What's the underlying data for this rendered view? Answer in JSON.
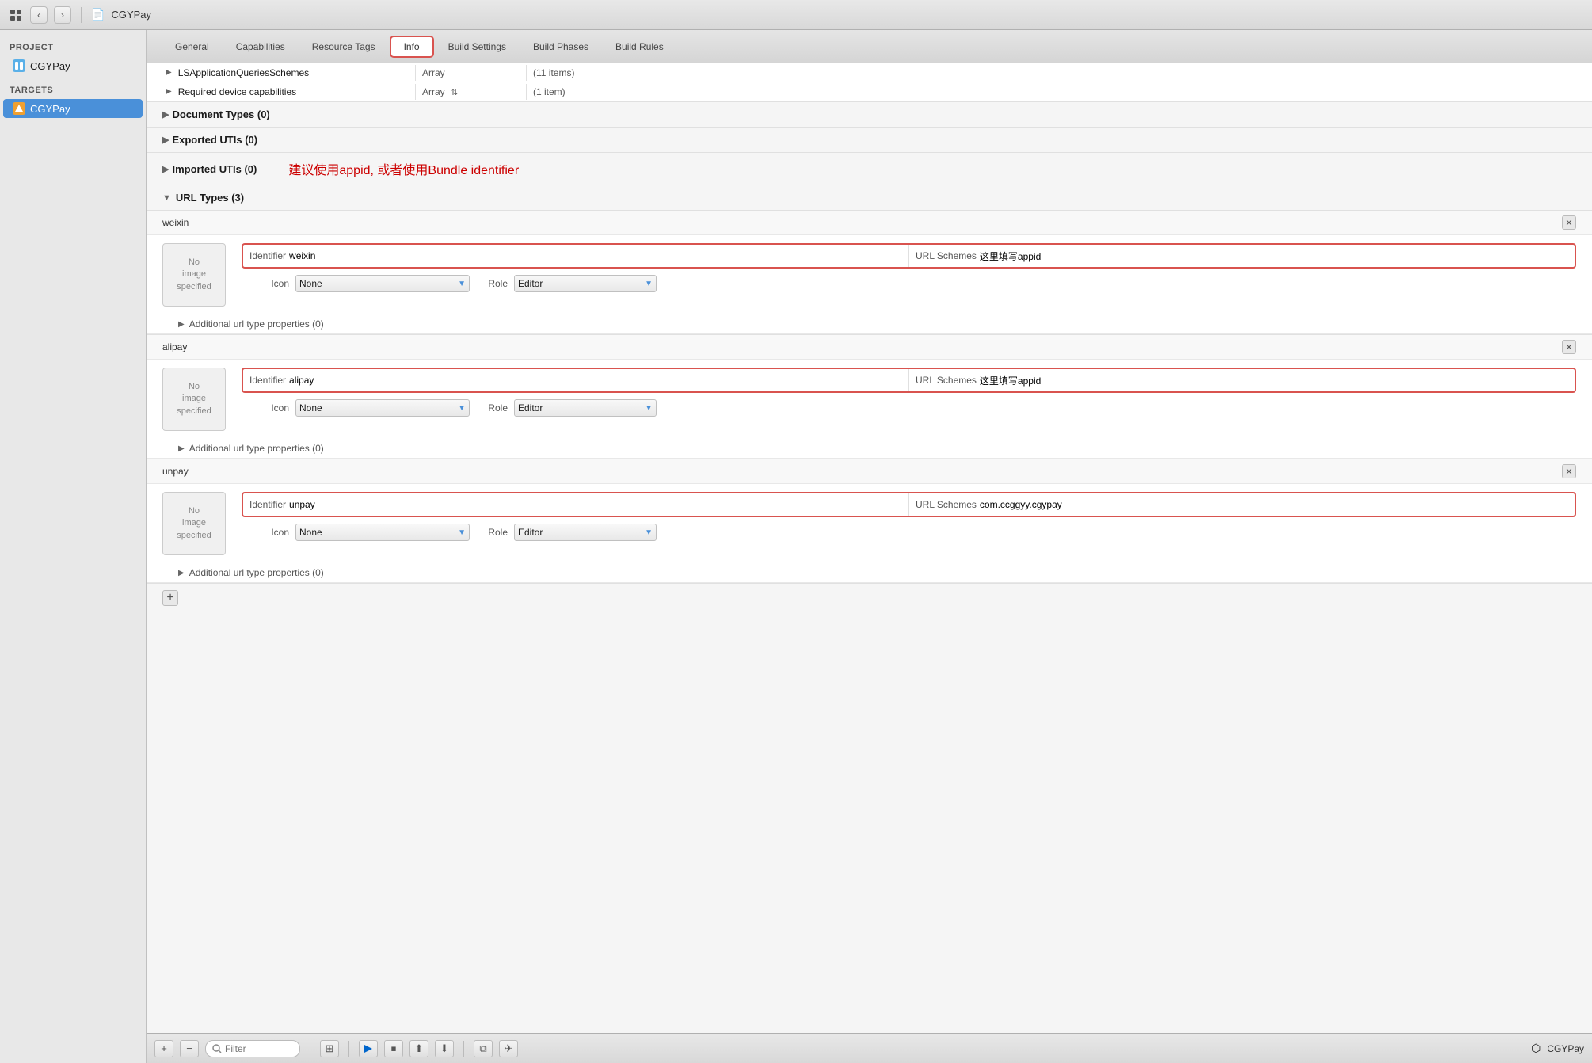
{
  "topToolbar": {
    "appName": "CGYPay",
    "navBack": "‹",
    "navForward": "›"
  },
  "sidebar": {
    "projectLabel": "PROJECT",
    "projectName": "CGYPay",
    "targetsLabel": "TARGETS",
    "targetName": "CGYPay"
  },
  "tabs": [
    {
      "label": "General",
      "active": false
    },
    {
      "label": "Capabilities",
      "active": false
    },
    {
      "label": "Resource Tags",
      "active": false
    },
    {
      "label": "Info",
      "active": true
    },
    {
      "label": "Build Settings",
      "active": false
    },
    {
      "label": "Build Phases",
      "active": false
    },
    {
      "label": "Build Rules",
      "active": false
    }
  ],
  "plistRows": [
    {
      "key": "LSApplicationQueriesSchemes",
      "type": "Array",
      "value": "(11 items)"
    },
    {
      "key": "Required device capabilities",
      "type": "Array",
      "value": "(1 item)"
    }
  ],
  "sections": [
    {
      "label": "Document Types (0)",
      "expanded": false
    },
    {
      "label": "Exported UTIs (0)",
      "expanded": false
    },
    {
      "label": "Imported UTIs (0)",
      "expanded": false
    }
  ],
  "advisoryText": "建议使用appid, 或者使用Bundle identifier",
  "urlTypesSection": {
    "label": "URL Types (3)",
    "expanded": true
  },
  "urlEntries": [
    {
      "name": "weixin",
      "identifier": "weixin",
      "urlSchemes": "这里填写appid",
      "icon": "None",
      "role": "Editor",
      "additionalLabel": "Additional url type properties (0)",
      "imageText": "No image specified"
    },
    {
      "name": "alipay",
      "identifier": "alipay",
      "urlSchemes": "这里填写appid",
      "icon": "None",
      "role": "Editor",
      "additionalLabel": "Additional url type properties (0)",
      "imageText": "No image specified"
    },
    {
      "name": "unpay",
      "identifier": "unpay",
      "urlSchemes": "com.ccggyy.cgypay",
      "icon": "None",
      "role": "Editor",
      "additionalLabel": "Additional url type properties (0)",
      "imageText": "No image specified"
    }
  ],
  "bottomToolbar": {
    "filterPlaceholder": "Filter",
    "schemeName": "CGYPay",
    "addLabel": "+",
    "removeLabel": "−"
  }
}
